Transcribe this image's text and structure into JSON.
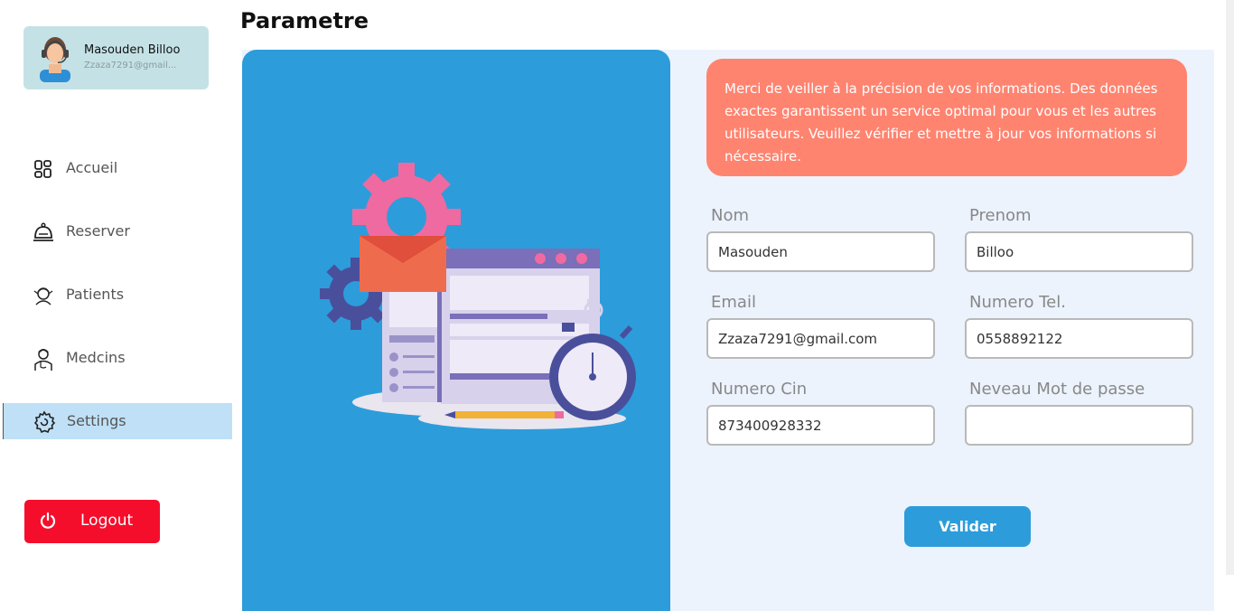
{
  "page": {
    "title": "Parametre"
  },
  "profile": {
    "name": "Masouden Billoo",
    "email": "Zzaza7291@gmail..."
  },
  "sidebar": {
    "items": [
      {
        "label": "Accueil",
        "icon": "grid-icon"
      },
      {
        "label": "Reserver",
        "icon": "bell-icon"
      },
      {
        "label": "Patients",
        "icon": "patient-icon"
      },
      {
        "label": "Medcins",
        "icon": "doctor-icon"
      },
      {
        "label": "Settings",
        "icon": "gear-icon",
        "active": true
      }
    ],
    "logout_label": "Logout"
  },
  "notice": "Merci de veiller à la précision de vos informations. Des données exactes garantissent un service optimal pour vous et les autres utilisateurs. Veuillez vérifier et mettre à jour vos informations si nécessaire.",
  "form": {
    "nom": {
      "label": "Nom",
      "value": "Masouden"
    },
    "prenom": {
      "label": "Prenom",
      "value": "Billoo"
    },
    "email": {
      "label": "Email",
      "value": "Zzaza7291@gmail.com"
    },
    "tel": {
      "label": "Numero Tel.",
      "value": "0558892122"
    },
    "cin": {
      "label": "Numero Cin",
      "value": "873400928332"
    },
    "password": {
      "label": "Neveau Mot de passe",
      "value": ""
    },
    "submit_label": "Valider"
  },
  "colors": {
    "accent": "#2d9cdb",
    "notice": "#fe8470",
    "logout": "#f50e2c",
    "active_nav": "#bfe0f7",
    "profile_card": "#c4e2e6"
  }
}
